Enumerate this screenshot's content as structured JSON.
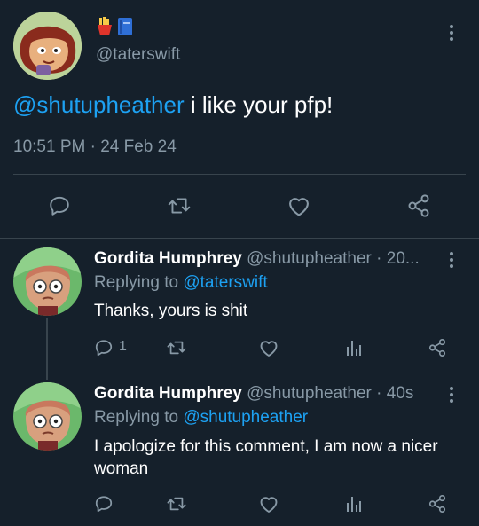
{
  "main_tweet": {
    "display_name_emojis": [
      "fries-emoji",
      "blue-book-emoji"
    ],
    "handle": "@taterswift",
    "mention": "@shutupheather",
    "text": " i like your pfp!",
    "time": "10:51 PM",
    "separator": "·",
    "date": "24 Feb 24"
  },
  "replies": [
    {
      "name": "Gordita Humphrey",
      "handle_time": "@shutupheather · 20...",
      "replying_prefix": "Replying to ",
      "replying_to": "@taterswift",
      "text": "Thanks, yours is shit",
      "reply_count": "1"
    },
    {
      "name": "Gordita Humphrey",
      "handle_time": "@shutupheather · 40s",
      "replying_prefix": "Replying to ",
      "replying_to": "@shutupheather",
      "text": "I apologize for this comment, I am now a nicer woman",
      "reply_count": ""
    }
  ],
  "colors": {
    "background": "#15202b",
    "muted": "#8899a6",
    "link": "#1da1f2",
    "divider": "#38444d"
  }
}
